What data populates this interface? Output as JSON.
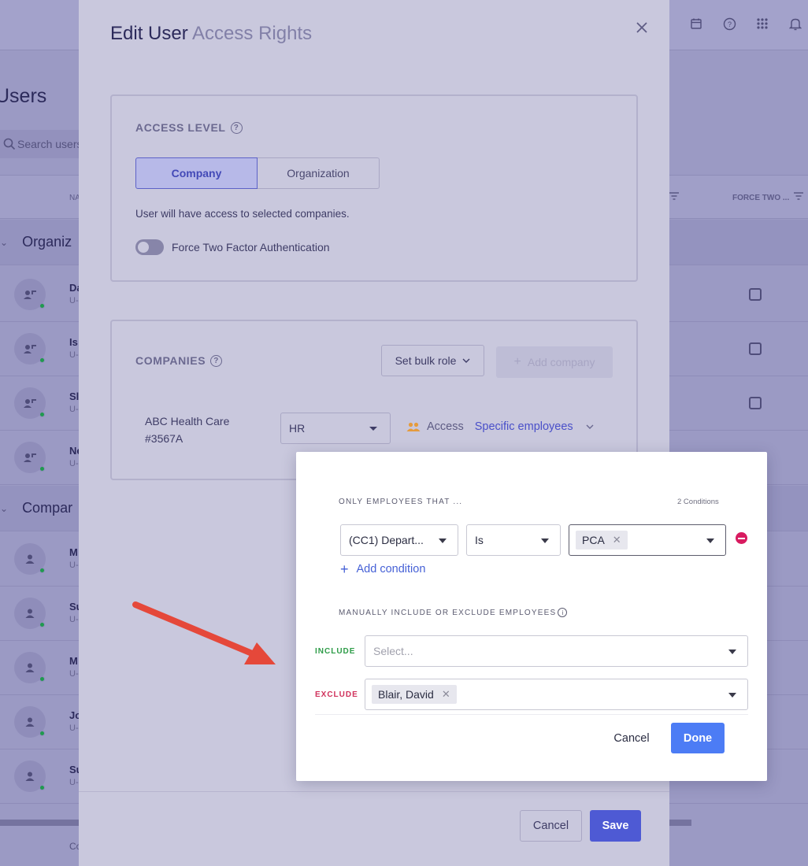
{
  "background": {
    "page_title": "Users",
    "search_placeholder": "Search users",
    "col_name": "NA",
    "col_force": "FORCE TWO ...",
    "groups": [
      {
        "label": "Organiz"
      },
      {
        "label": "Compar"
      }
    ],
    "rows": [
      {
        "name": "Da",
        "sub": "U-",
        "checkbox": true
      },
      {
        "name": "Is",
        "sub": "U-",
        "checkbox": true
      },
      {
        "name": "Sl",
        "sub": "U-",
        "checkbox": true
      },
      {
        "name": "Ne",
        "sub": "U-",
        "checkbox": false
      },
      {
        "name": "M",
        "sub": "U-",
        "checkbox": false
      },
      {
        "name": "Su",
        "sub": "U-",
        "checkbox": false
      },
      {
        "name": "M",
        "sub": "U-",
        "checkbox": false
      },
      {
        "name": "Jo",
        "sub": "U-",
        "checkbox": false
      },
      {
        "name": "Su",
        "sub": "U-",
        "checkbox": false
      }
    ],
    "footer_text": "Co"
  },
  "modal": {
    "title": "Edit User",
    "title_suffix": "Access Rights",
    "access_level": {
      "label": "ACCESS LEVEL",
      "tabs": [
        "Company",
        "Organization"
      ],
      "active_tab": "Company",
      "help_text": "User will have access to selected companies.",
      "force_2fa_label": "Force Two Factor Authentication",
      "force_2fa_enabled": false
    },
    "companies": {
      "label": "COMPANIES",
      "bulk_role_label": "Set bulk role",
      "add_company_label": "Add company",
      "company_name": "ABC Health Care",
      "company_id": "#3567A",
      "role_value": "HR",
      "access_label": "Access",
      "access_value": "Specific employees"
    },
    "footer": {
      "cancel_label": "Cancel",
      "save_label": "Save"
    }
  },
  "popover": {
    "conditions_label": "ONLY EMPLOYEES THAT ...",
    "conditions_count": "2 Conditions",
    "condition": {
      "field": "(CC1) Depart...",
      "operator": "Is",
      "value_chip": "PCA"
    },
    "add_condition_label": "Add condition",
    "manual_label": "MANUALLY INCLUDE OR EXCLUDE EMPLOYEES",
    "include_label": "INCLUDE",
    "include_placeholder": "Select...",
    "exclude_label": "EXCLUDE",
    "exclude_chip": "Blair, David",
    "cancel_label": "Cancel",
    "done_label": "Done"
  },
  "colors": {
    "accent": "#4c7cf5",
    "save": "#4e5ad4",
    "include": "#2e9c48",
    "exclude": "#d0315b",
    "remove": "#d81b60",
    "arrow": "#e5483a"
  }
}
